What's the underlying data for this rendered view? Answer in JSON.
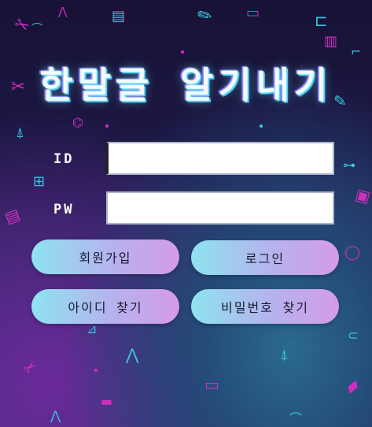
{
  "title": "한말글 알기내기",
  "form": {
    "id_label": "ID",
    "pw_label": "PW",
    "id_value": "",
    "pw_value": ""
  },
  "buttons": {
    "signup": "회원가입",
    "login": "로그인",
    "find_id": "아이디 찾기",
    "find_pw": "비밀번호 찾기"
  },
  "decorations": [
    {
      "name": "pencil-icon",
      "glyph": "✎"
    },
    {
      "name": "ruler-icon",
      "glyph": "📐"
    },
    {
      "name": "paperclip-icon",
      "glyph": "📎"
    },
    {
      "name": "scissors-icon",
      "glyph": "✂"
    },
    {
      "name": "compass-icon",
      "glyph": "⊼"
    }
  ],
  "colors": {
    "accent_cyan": "#35c8e0",
    "accent_magenta": "#d12fbf",
    "button_gradient_start": "#8ee3ef",
    "button_gradient_end": "#d59be9"
  }
}
